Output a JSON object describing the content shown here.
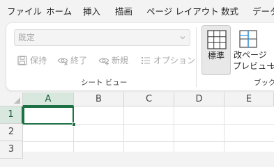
{
  "menu": {
    "tabs": [
      {
        "label": "ファイル"
      },
      {
        "label": "ホーム"
      },
      {
        "label": "挿入"
      },
      {
        "label": "描画"
      },
      {
        "label": "ページ レイアウト"
      },
      {
        "label": "数式"
      },
      {
        "label": "データ"
      }
    ]
  },
  "sheet_view": {
    "dropdown_value": "既定",
    "buttons": [
      {
        "label": "保持",
        "icon": "save-icon"
      },
      {
        "label": "終了",
        "icon": "eye-close-icon"
      },
      {
        "label": "新規",
        "icon": "eye-new-icon"
      },
      {
        "label": "オプション",
        "icon": "options-list-icon"
      }
    ],
    "group_label": "シート ビュー"
  },
  "workbook_view": {
    "normal_label": "標準",
    "page_break_label_line1": "改ページ",
    "page_break_label_line2": "プレビュー",
    "page_layout_label_fragment": "レ",
    "group_label": "ブック"
  },
  "grid": {
    "columns": [
      "A",
      "B",
      "C",
      "D",
      "E"
    ],
    "rows": [
      "1",
      "2",
      "3"
    ],
    "active_column": "A",
    "active_row": "1"
  },
  "colors": {
    "accent": "#1e7145",
    "ribbon_bg": "#ffffff",
    "window_bg": "#f3f3f3"
  }
}
